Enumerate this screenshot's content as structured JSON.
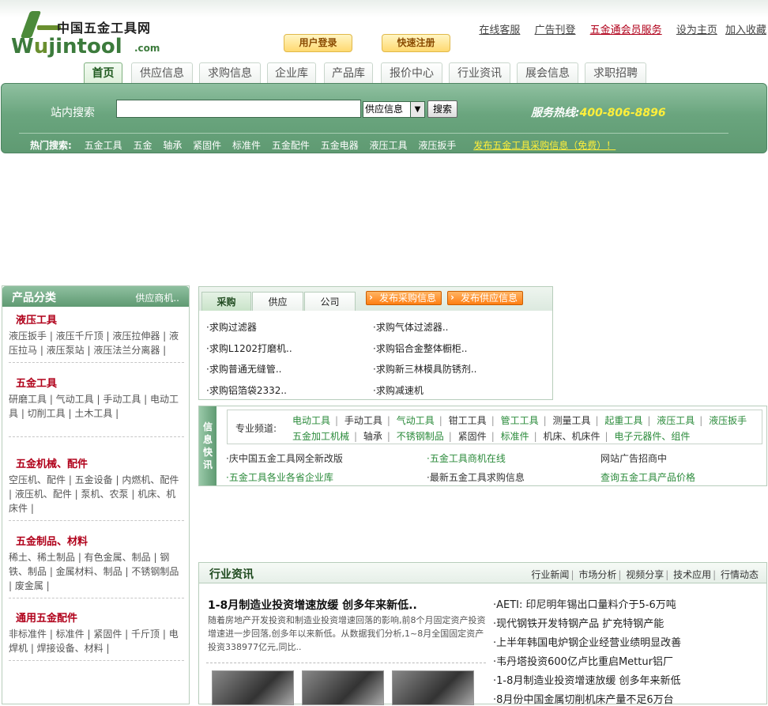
{
  "site": {
    "name_cn": "中国五金工具网",
    "logo_w": "W",
    "logo_u": "u",
    "logo_rest": "jintool",
    "logo_com": ".com"
  },
  "header": {
    "login": "用户登录",
    "register": "快速注册",
    "links": [
      "在线客服",
      "广告刊登",
      "五金通会员服务",
      "设为主页",
      "加入收藏"
    ]
  },
  "nav": {
    "tabs": [
      "首页",
      "供应信息",
      "求购信息",
      "企业库",
      "产品库",
      "报价中心",
      "行业资讯",
      "展会信息",
      "求职招聘"
    ]
  },
  "search": {
    "label": "站内搜索",
    "input_value": "",
    "category": "供应信息",
    "button": "搜索",
    "hotline_label": "服务热线:",
    "hotline_number": "400-806-8896",
    "hot_label": "热门搜索:",
    "hot_terms": [
      "五金工具",
      "五金",
      "轴承",
      "紧固件",
      "标准件",
      "五金配件",
      "五金电器",
      "液压工具",
      "液压扳手"
    ],
    "publish_link": "发布五金工具采购信息（免费）！"
  },
  "left": {
    "title": "产品分类",
    "more": "供应商机..",
    "categories": [
      {
        "name": "液压工具",
        "items": "液压扳手 | 液压千斤顶 | 液压拉伸器 | 液压拉马 | 液压泵站 | 液压法兰分离器 |"
      },
      {
        "name": "五金工具",
        "items": "研磨工具 | 气动工具 | 手动工具 | 电动工具 | 切削工具 | 土木工具 |"
      },
      {
        "name": "五金机械、配件",
        "items": "空压机、配件 | 五金设备 | 内燃机、配件 | 液压机、配件 | 泵机、农泵 | 机床、机床件 |"
      },
      {
        "name": "五金制品、材料",
        "items": "稀土、稀土制品 | 有色金属、制品 | 钢铁、制品 | 金属材料、制品 | 不锈钢制品 | 废金属 |"
      },
      {
        "name": "通用五金配件",
        "items": "非标准件 | 标准件 | 紧固件 | 千斤顶 | 电焊机 | 焊接设备、材料 |"
      }
    ]
  },
  "buy": {
    "tabs": [
      "采购",
      "供应",
      "公司"
    ],
    "publish_buy": "发布采购信息",
    "publish_supply": "发布供应信息",
    "items_left": [
      "·求购过滤器",
      "·求购L1202打磨机..",
      "·求购普通无缝管..",
      "·求购铝箔袋2332.."
    ],
    "items_right": [
      "·求购气体过滤器..",
      "·求购铝合金整体橱柜..",
      "·求购新三林模具防锈剂..",
      "·求购减速机"
    ]
  },
  "info": {
    "vlabel": "信息快讯",
    "channel_label": "专业频道:",
    "row1": [
      "电动工具",
      "手动工具",
      "气动工具",
      "钳工工具",
      "管工工具",
      "测量工具",
      "起重工具",
      "液压工具",
      "液压扳手"
    ],
    "row2": [
      "五金加工机械",
      "轴承",
      "不锈钢制品",
      "紧固件",
      "标准件",
      "机床、机床件",
      "电子元器件、组件"
    ],
    "links": [
      "·庆中国五金工具网全新改版",
      "·五金工具商机在线",
      "网站广告招商中",
      "·五金工具各业各省企业库",
      "·最新五金工具求购信息",
      "查询五金工具产品价格"
    ]
  },
  "news": {
    "title": "行业资讯",
    "links": [
      "行业新闻",
      "市场分析",
      "视频分享",
      "技术应用",
      "行情动态"
    ],
    "headline": "1-8月制造业投资增速放缓  创多年来新低..",
    "summary": "随着房地产开发投资和制造业投资增速回落的影响,前8个月固定资产投资增速进一步回落,创多年以来新低。从数据我们分析,1~8月全国固定资产投资338977亿元,同比..",
    "items": [
      "·AETI: 印尼明年锡出口量料介于5-6万吨",
      "·现代钢铁开发特钢产品  扩充特钢产能",
      "·上半年韩国电炉钢企业经营业绩明显改善",
      "·韦丹塔投资600亿卢比重启Mettur铝厂",
      "·1-8月制造业投资增速放缓  创多年来新低",
      "·8月份中国金属切削机床产量不足6万台"
    ]
  }
}
